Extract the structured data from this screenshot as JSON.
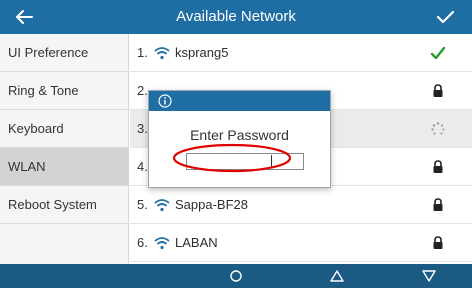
{
  "header": {
    "title": "Available Network",
    "back_icon": "arrow-left-icon",
    "confirm_icon": "checkmark-icon",
    "bar_color": "#1f6ea3"
  },
  "sidebar": {
    "items": [
      {
        "label": "UI Preference"
      },
      {
        "label": "Ring & Tone"
      },
      {
        "label": "Keyboard"
      },
      {
        "label": "WLAN",
        "active": true
      },
      {
        "label": "Reboot System"
      }
    ]
  },
  "networks": [
    {
      "num": "1.",
      "ssid": "ksprang5",
      "status_icon": "checkmark-icon",
      "status_color": "#2a9a2a"
    },
    {
      "num": "2.",
      "ssid": "",
      "status_icon": "lock-icon"
    },
    {
      "num": "3.",
      "ssid": "",
      "status_icon": "loading-spinner-icon"
    },
    {
      "num": "4.",
      "ssid": "",
      "status_icon": "lock-icon"
    },
    {
      "num": "5.",
      "ssid": "Sappa-BF28",
      "status_icon": "lock-icon"
    },
    {
      "num": "6.",
      "ssid": "LABAN",
      "status_icon": "lock-icon"
    }
  ],
  "dialog": {
    "prompt": "Enter Password",
    "password_value": "",
    "info_icon": "info-icon",
    "annotation_color": "#e00000"
  },
  "softkeys": {
    "icons": [
      "circle-icon",
      "triangle-up-icon",
      "triangle-down-icon"
    ],
    "bar_color": "#1a5a83"
  }
}
